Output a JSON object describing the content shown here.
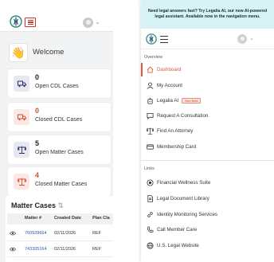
{
  "welcome": {
    "text": "Welcome"
  },
  "cards": [
    {
      "count": "0",
      "label": "Open CDL Cases",
      "icon": "truck-icon",
      "accent": "#27306b"
    },
    {
      "count": "0",
      "label": "Closed CDL Cases",
      "icon": "truck-icon",
      "accent": "#d4502d"
    },
    {
      "count": "5",
      "label": "Open Matter Cases",
      "icon": "scales-icon",
      "accent": "#27306b"
    },
    {
      "count": "4",
      "label": "Closed Matter Cases",
      "icon": "scales-icon",
      "accent": "#d4502d"
    }
  ],
  "matter_cases": {
    "title": "Matter Cases",
    "columns": [
      "Matter #",
      "Created Date",
      "Plan Cla"
    ],
    "rows": [
      {
        "matter": "760929664",
        "date": "02/11/2026",
        "plan": "REF"
      },
      {
        "matter": "743305164",
        "date": "02/11/2026",
        "plan": "REF"
      }
    ]
  },
  "banner": {
    "text": "Need legal answers fast? Try Legalia AI, our new AI-powered legal assistant. Available now in the navigation menu."
  },
  "nav": {
    "overview_label": "Overview",
    "links_label": "Links",
    "overview_items": [
      {
        "label": "Dashboard",
        "icon": "home-icon",
        "active": true
      },
      {
        "label": "My Account",
        "icon": "user-icon"
      },
      {
        "label": "Legalia AI",
        "icon": "robot-icon",
        "badge": "New Beta"
      },
      {
        "label": "Request A Consultation",
        "icon": "chat-icon"
      },
      {
        "label": "Find An Attorney",
        "icon": "scales-icon"
      },
      {
        "label": "Membership Card",
        "icon": "card-icon"
      }
    ],
    "link_items": [
      {
        "label": "Financial Wellness Suite",
        "icon": "coin-icon"
      },
      {
        "label": "Legal Document Library",
        "icon": "document-icon"
      },
      {
        "label": "Identity Monitoring Services",
        "icon": "link-icon"
      },
      {
        "label": "Call Member Care",
        "icon": "phone-icon"
      },
      {
        "label": "U.S. Legal Website",
        "icon": "globe-icon"
      }
    ]
  },
  "colors": {
    "accent": "#e05a3d",
    "brand_teal": "#2f8f83",
    "banner_bg": "#d7f3f5",
    "link_blue": "#2c5aa0"
  }
}
